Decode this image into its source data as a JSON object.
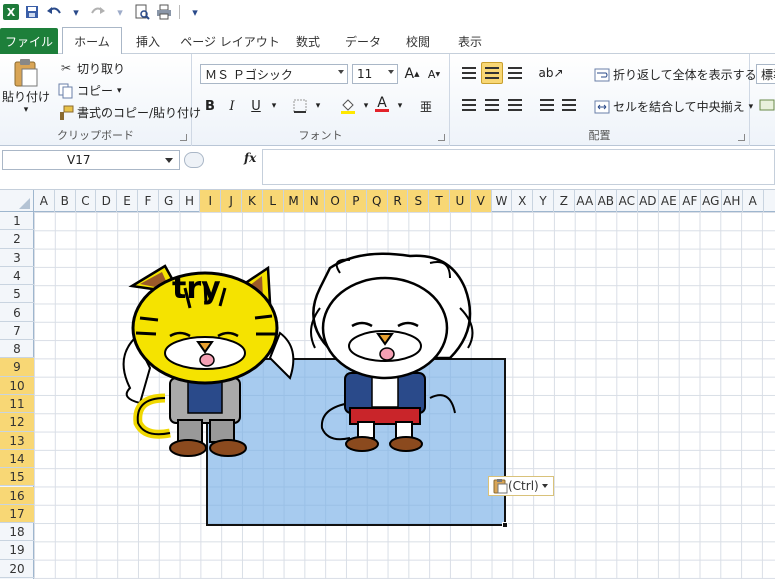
{
  "qat": {
    "excel_icon_label": "X"
  },
  "tabs": [
    "ファイル",
    "ホーム",
    "挿入",
    "ページ レイアウト",
    "数式",
    "データ",
    "校閲",
    "表示"
  ],
  "clipboard": {
    "paste_label": "貼り付け",
    "cut_label": "切り取り",
    "copy_label": "コピー",
    "format_painter_label": "書式のコピー/貼り付け",
    "group_label": "クリップボード"
  },
  "font": {
    "font_name": "ＭＳ Ｐゴシック",
    "font_size": "11",
    "grow_label": "A",
    "shrink_label": "A",
    "bold": "B",
    "italic": "I",
    "underline": "U",
    "font_color_label": "A",
    "phonetic_label": "亜",
    "group_label": "フォント",
    "colors": {
      "fill": "#ffe800",
      "font": "#e3222a"
    }
  },
  "alignment": {
    "wrap_label": "折り返して全体を表示する",
    "merge_label": "セルを結合して中央揃え",
    "group_label": "配置"
  },
  "number": {
    "format_label": "標準"
  },
  "formula_bar": {
    "name_box": "V17",
    "fx": "fx",
    "formula": ""
  },
  "columns": [
    "A",
    "B",
    "C",
    "D",
    "E",
    "F",
    "G",
    "H",
    "I",
    "J",
    "K",
    "L",
    "M",
    "N",
    "O",
    "P",
    "Q",
    "R",
    "S",
    "T",
    "U",
    "V",
    "W",
    "X",
    "Y",
    "Z",
    "AA",
    "AB",
    "AC",
    "AD",
    "AE",
    "AF",
    "AG",
    "AH",
    "A"
  ],
  "selected_columns": [
    "I",
    "J",
    "K",
    "L",
    "M",
    "N",
    "O",
    "P",
    "Q",
    "R",
    "S",
    "T",
    "U",
    "V"
  ],
  "rows": [
    "1",
    "2",
    "3",
    "4",
    "5",
    "6",
    "7",
    "8",
    "9",
    "10",
    "11",
    "12",
    "13",
    "14",
    "15",
    "16",
    "17",
    "18",
    "19",
    "20"
  ],
  "selected_rows": [
    "9",
    "10",
    "11",
    "12",
    "13",
    "14",
    "15",
    "16",
    "17"
  ],
  "paste_options": {
    "label": "(Ctrl)"
  },
  "illustration": {
    "shirt_text": "try"
  }
}
